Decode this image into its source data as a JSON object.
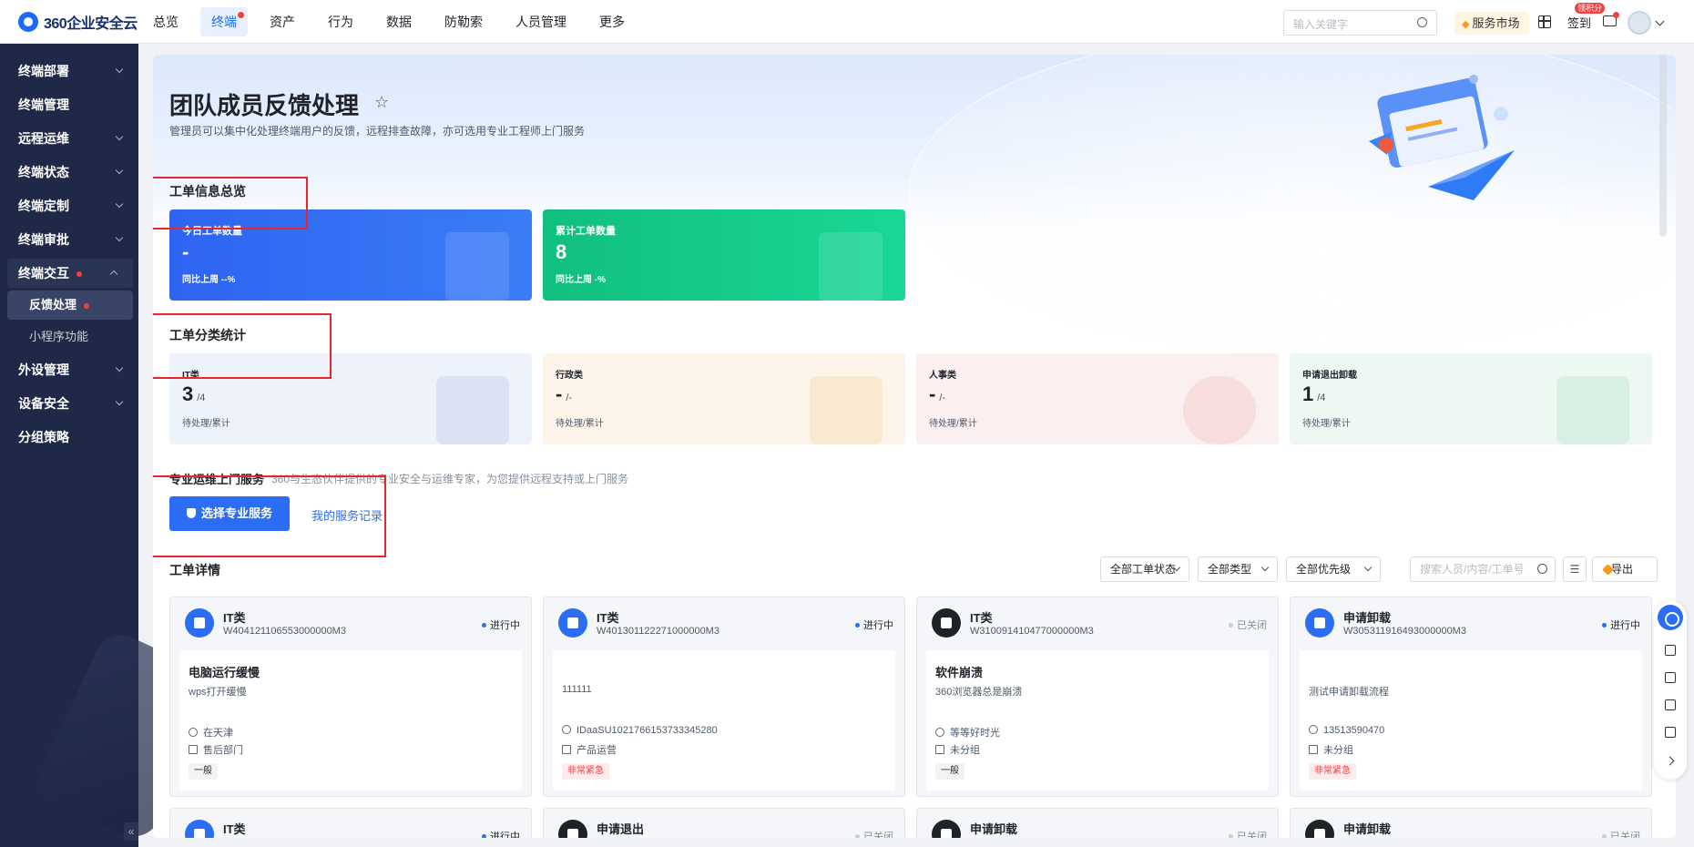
{
  "topbar": {
    "logo_text": "360企业安全云",
    "nav": [
      {
        "label": "总览",
        "active": false,
        "dot": false
      },
      {
        "label": "终端",
        "active": true,
        "dot": true
      },
      {
        "label": "资产",
        "active": false,
        "dot": false
      },
      {
        "label": "行为",
        "active": false,
        "dot": false
      },
      {
        "label": "数据",
        "active": false,
        "dot": false
      },
      {
        "label": "防勒索",
        "active": false,
        "dot": false
      },
      {
        "label": "人员管理",
        "active": false,
        "dot": false
      },
      {
        "label": "更多",
        "active": false,
        "dot": false
      }
    ],
    "search_placeholder": "输入关键字",
    "market_label": "服务市场",
    "signin_label": "签到",
    "signin_badge": "领积分"
  },
  "sidebar": {
    "items": [
      {
        "label": "终端部署",
        "arrow": true
      },
      {
        "label": "终端管理",
        "arrow": false
      },
      {
        "label": "远程运维",
        "arrow": true
      },
      {
        "label": "终端状态",
        "arrow": true
      },
      {
        "label": "终端定制",
        "arrow": true
      },
      {
        "label": "终端审批",
        "arrow": true
      },
      {
        "label": "终端交互",
        "arrow": true,
        "expanded": true,
        "dot": true
      },
      {
        "label": "外设管理",
        "arrow": true
      },
      {
        "label": "设备安全",
        "arrow": true
      },
      {
        "label": "分组策略",
        "arrow": false
      }
    ],
    "sub_items": [
      {
        "label": "反馈处理",
        "active": true,
        "dot": true
      },
      {
        "label": "小程序功能",
        "active": false,
        "dot": false
      }
    ],
    "collapse_label": "«"
  },
  "page": {
    "title": "团队成员反馈处理",
    "description": "管理员可以集中化处理终端用户的反馈，远程排查故障，亦可选用专业工程师上门服务"
  },
  "overview": {
    "title": "工单信息总览",
    "cards": [
      {
        "label": "今日工单数量",
        "value": "-",
        "compare": "同比上周 --%",
        "color": "#2f6ff5"
      },
      {
        "label": "累计工单数量",
        "value": "8",
        "compare": "同比上周 -%",
        "color": "#13c585"
      }
    ]
  },
  "category": {
    "title": "工单分类统计",
    "cards": [
      {
        "label": "IT类",
        "value": "3",
        "total": "/4",
        "sub": "待处理/累计",
        "bg": "#edf2fb",
        "deco": "#b7c7e6"
      },
      {
        "label": "行政类",
        "value": "-",
        "total": "/-",
        "sub": "待处理/累计",
        "bg": "#fdf4ea",
        "deco": "#f3d3a3"
      },
      {
        "label": "人事类",
        "value": "-",
        "total": "/-",
        "sub": "待处理/累计",
        "bg": "#fcefef",
        "deco": "#f0bcbc"
      },
      {
        "label": "申请退出卸载",
        "value": "1",
        "total": "/4",
        "sub": "待处理/累计",
        "bg": "#edf8f2",
        "deco": "#b3e2c8"
      }
    ]
  },
  "service": {
    "title": "专业运维上门服务",
    "description": "360与生态伙伴提供的专业安全与运维专家，为您提供远程支持或上门服务",
    "primary_button": "选择专业服务",
    "link": "我的服务记录"
  },
  "details": {
    "title": "工单详情",
    "filters": [
      "全部工单状态",
      "全部类型",
      "全部优先级"
    ],
    "search_placeholder": "搜索人员/内容/工单号",
    "export_label": "导出",
    "tickets": [
      {
        "category": "IT类",
        "number": "W404121106553000000M3",
        "status": "进行中",
        "closed": false,
        "dark": false,
        "title": "电脑运行缓慢",
        "desc": "wps打开缓慢",
        "user": "在天津",
        "dept": "售后部门",
        "priority": "一般",
        "urgent": false
      },
      {
        "category": "IT类",
        "number": "W401301122271000000M3",
        "status": "进行中",
        "closed": false,
        "dark": false,
        "title": "",
        "desc": "111111",
        "user": "IDaaSU1021766153733345280",
        "dept": "产品运营",
        "priority": "非常紧急",
        "urgent": true
      },
      {
        "category": "IT类",
        "number": "W310091410477000000M3",
        "status": "已关闭",
        "closed": true,
        "dark": true,
        "title": "软件崩溃",
        "desc": "360浏览器总是崩溃",
        "user": "等等好时光",
        "dept": "未分组",
        "priority": "一般",
        "urgent": false
      },
      {
        "category": "申请卸载",
        "number": "W305311916493000000M3",
        "status": "进行中",
        "closed": false,
        "dark": false,
        "title": "",
        "desc": "测试申请卸载流程",
        "user": "13513590470",
        "dept": "未分组",
        "priority": "非常紧急",
        "urgent": true
      }
    ],
    "next_row": [
      {
        "category": "IT类",
        "status": "进行中",
        "closed": false,
        "dark": false
      },
      {
        "category": "申请退出",
        "status": "已关闭",
        "closed": true,
        "dark": true
      },
      {
        "category": "申请卸载",
        "status": "已关闭",
        "closed": true,
        "dark": true
      },
      {
        "category": "申请卸载",
        "status": "已关闭",
        "closed": true,
        "dark": true
      }
    ]
  }
}
